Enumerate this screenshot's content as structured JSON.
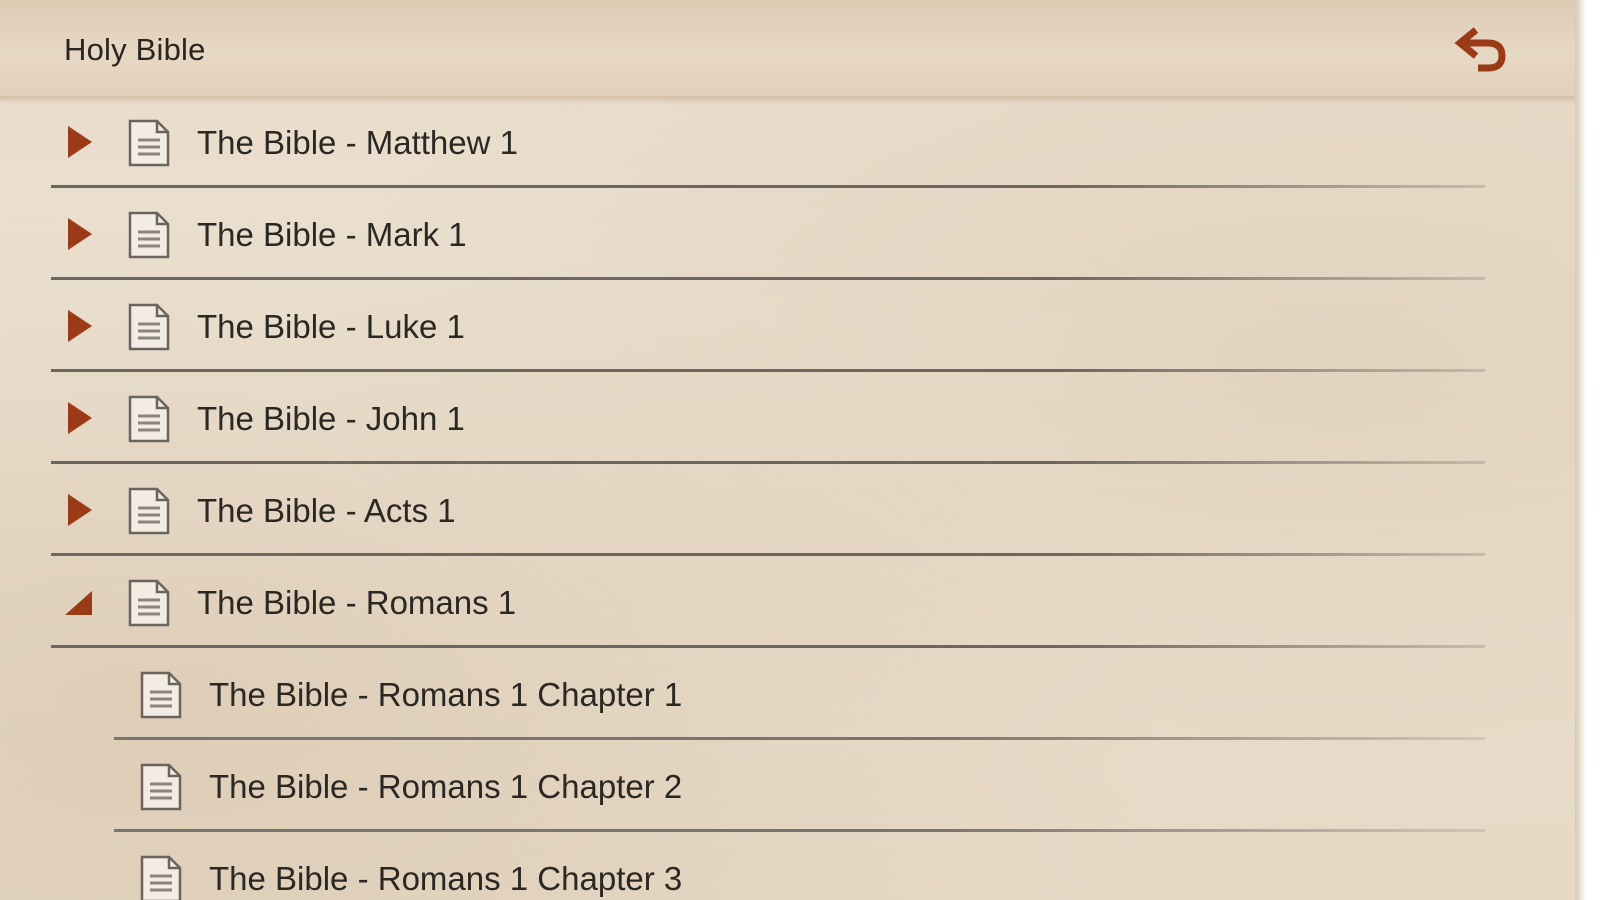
{
  "header": {
    "title": "Holy Bible",
    "back_icon": "undo-arrow-icon"
  },
  "colors": {
    "accent": "#9a3a17",
    "text": "#2b2824",
    "divider": "#6c6660",
    "paper": "#e9dccb"
  },
  "list": {
    "items": [
      {
        "label": "The Bible - Matthew 1",
        "state": "collapsed",
        "icon": "document-icon"
      },
      {
        "label": "The Bible - Mark 1",
        "state": "collapsed",
        "icon": "document-icon"
      },
      {
        "label": "The Bible - Luke 1",
        "state": "collapsed",
        "icon": "document-icon"
      },
      {
        "label": "The Bible - John 1",
        "state": "collapsed",
        "icon": "document-icon"
      },
      {
        "label": "The Bible - Acts 1",
        "state": "collapsed",
        "icon": "document-icon"
      },
      {
        "label": "The Bible - Romans 1",
        "state": "expanded",
        "icon": "document-icon"
      }
    ],
    "children": [
      {
        "label": "The Bible - Romans 1 Chapter 1",
        "icon": "document-icon"
      },
      {
        "label": "The Bible - Romans 1 Chapter 2",
        "icon": "document-icon"
      },
      {
        "label": "The Bible - Romans 1 Chapter 3",
        "icon": "document-icon"
      }
    ]
  }
}
